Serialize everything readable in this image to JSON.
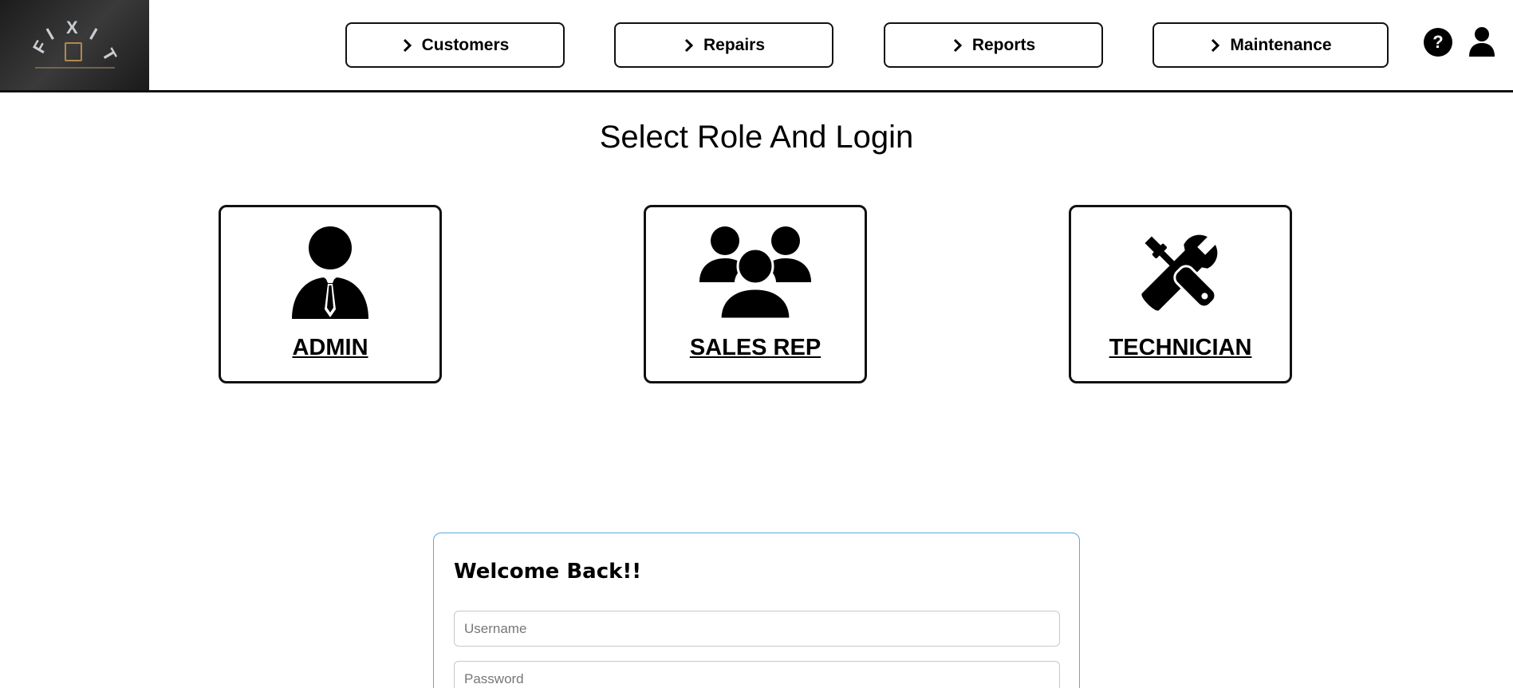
{
  "header": {
    "logo": {
      "letters": [
        "F",
        "I",
        "X",
        "I",
        "T"
      ],
      "alt": "FIXIT"
    },
    "nav": [
      {
        "label": "Customers"
      },
      {
        "label": "Repairs"
      },
      {
        "label": "Reports"
      },
      {
        "label": "Maintenance"
      }
    ],
    "help_icon": {
      "glyph": "?",
      "icon": "help-icon"
    },
    "user_icon": {
      "icon": "user-icon"
    }
  },
  "main": {
    "title": "Select Role And Login",
    "roles": [
      {
        "label": "ADMIN",
        "icon": "admin-icon"
      },
      {
        "label": "SALES REP",
        "icon": "group-icon"
      },
      {
        "label": "TECHNICIAN",
        "icon": "tools-icon"
      }
    ]
  },
  "login": {
    "title": "Welcome Back!!",
    "username_placeholder": "Username",
    "password_placeholder": "Password"
  },
  "colors": {
    "accent_border": "#5aa8d8",
    "text": "#000000",
    "logo_bg": "#2a2a2a"
  }
}
